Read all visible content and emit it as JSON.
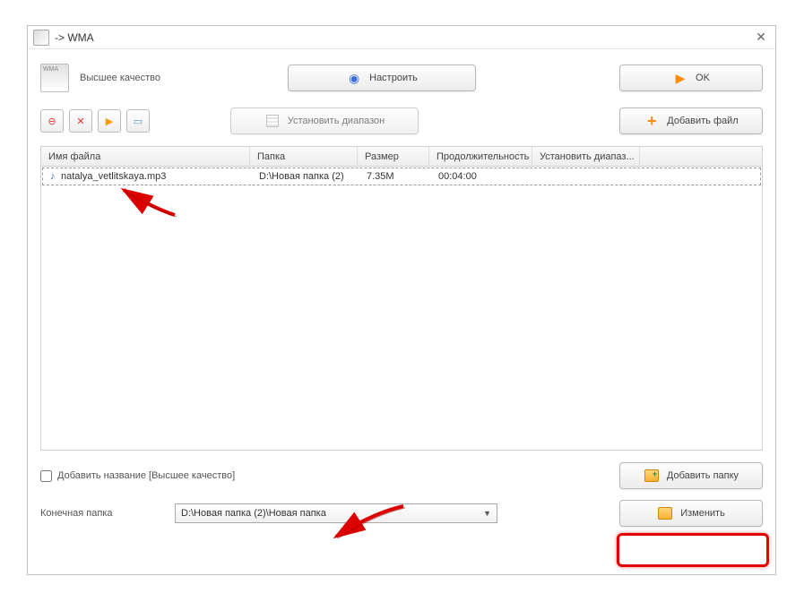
{
  "window": {
    "title": "-> WMA"
  },
  "top": {
    "quality_label": "Высшее качество",
    "config_btn": "Настроить",
    "ok_btn": "OK",
    "range_btn": "Установить диапазон",
    "addfile_btn": "Добавить файл"
  },
  "table": {
    "headers": {
      "name": "Имя файла",
      "folder": "Папка",
      "size": "Размер",
      "duration": "Продолжительность",
      "range": "Установить диапаз..."
    },
    "rows": [
      {
        "name": "natalya_vetlitskaya.mp3",
        "folder": "D:\\Новая папка (2)",
        "size": "7.35M",
        "duration": "00:04:00",
        "range": ""
      }
    ]
  },
  "bottom": {
    "add_title_label": "Добавить название [Высшее качество]",
    "addfolder_btn": "Добавить папку",
    "dest_label": "Конечная папка",
    "dest_value": "D:\\Новая папка (2)\\Новая папка",
    "change_btn": "Изменить"
  }
}
